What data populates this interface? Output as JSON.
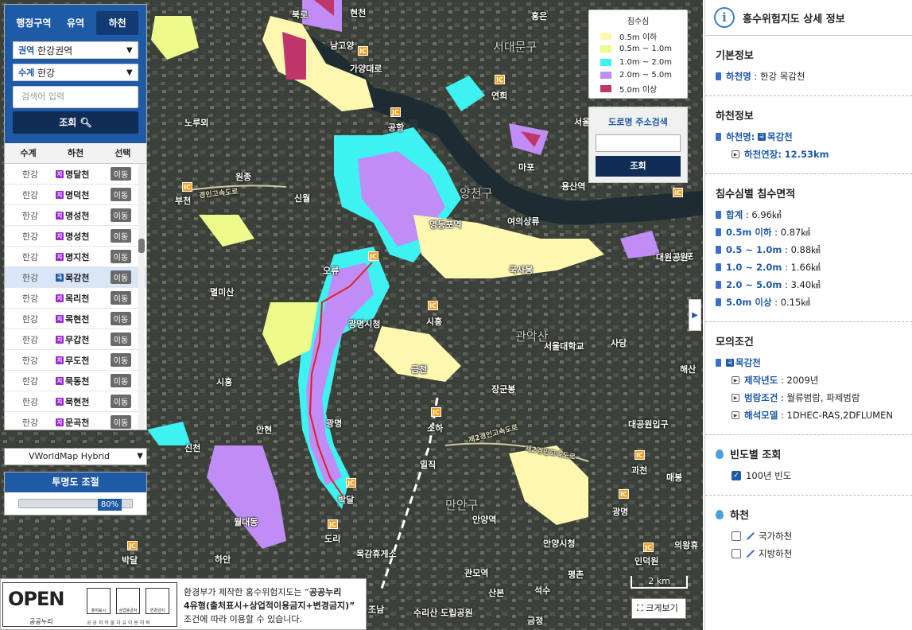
{
  "map": {
    "labels": [
      "북로",
      "현천",
      "남고양",
      "가양대로",
      "홍은",
      "서대문구",
      "연희",
      "노루뫼",
      "원종",
      "신월",
      "공항",
      "부천",
      "마포",
      "용산역",
      "서울",
      "양천구",
      "영등포역",
      "여의상류",
      "오류",
      "광명시청",
      "시흥",
      "국사봉",
      "관악산",
      "서울대학교",
      "사당",
      "반포",
      "멸미산",
      "광명",
      "금천",
      "장군봉",
      "해산",
      "안현",
      "시흥",
      "일직",
      "신천",
      "대공원입구",
      "대원공원",
      "과천",
      "매봉",
      "광명",
      "박달",
      "월대동",
      "도리",
      "소하",
      "안양역",
      "안양시청",
      "인덕원",
      "의왕휴",
      "하안",
      "박달",
      "만안구",
      "관모역",
      "평촌",
      "석수",
      "수리산 도립공원",
      "목감휴게소",
      "조남",
      "금정",
      "산본"
    ],
    "roads": [
      "경인고속도로",
      "제2경인고속도로",
      "제2경인고속도로"
    ],
    "scale": "2 km",
    "enlarge": "크게보기"
  },
  "left": {
    "tabs": [
      "행정구역",
      "유역",
      "하천"
    ],
    "region_key": "권역",
    "region_val": "한강권역",
    "system_key": "수계",
    "system_val": "한강",
    "search_placeholder": "검색어 입력",
    "search_btn": "조회",
    "cols": [
      "수계",
      "하천",
      "선택"
    ],
    "rows": [
      {
        "sys": "한강",
        "badge": "지",
        "name": "명달천",
        "btn": "이동"
      },
      {
        "sys": "한강",
        "badge": "지",
        "name": "명덕천",
        "btn": "이동"
      },
      {
        "sys": "한강",
        "badge": "지",
        "name": "명성천",
        "btn": "이동"
      },
      {
        "sys": "한강",
        "badge": "지",
        "name": "명성천",
        "btn": "이동"
      },
      {
        "sys": "한강",
        "badge": "지",
        "name": "명지천",
        "btn": "이동"
      },
      {
        "sys": "한강",
        "badge": "국",
        "name": "목감천",
        "btn": "이동"
      },
      {
        "sys": "한강",
        "badge": "지",
        "name": "목리천",
        "btn": "이동"
      },
      {
        "sys": "한강",
        "badge": "지",
        "name": "목현천",
        "btn": "이동"
      },
      {
        "sys": "한강",
        "badge": "지",
        "name": "무갑천",
        "btn": "이동"
      },
      {
        "sys": "한강",
        "badge": "지",
        "name": "무도천",
        "btn": "이동"
      },
      {
        "sys": "한강",
        "badge": "지",
        "name": "묵동천",
        "btn": "이동"
      },
      {
        "sys": "한강",
        "badge": "지",
        "name": "묵현천",
        "btn": "이동"
      },
      {
        "sys": "한강",
        "badge": "지",
        "name": "문곡천",
        "btn": "이동"
      }
    ],
    "basemap": "VWorldMap Hybrid",
    "opacity_title": "투명도 조절",
    "opacity": "80%"
  },
  "legend": {
    "title": "침수심",
    "items": [
      {
        "label": "0.5m 이하",
        "color": "#fdf7b0"
      },
      {
        "label": "0.5m ~ 1.0m",
        "color": "#ecfb8a"
      },
      {
        "label": "1.0m ~ 2.0m",
        "color": "#3ef2f2"
      },
      {
        "label": "2.0m ~ 5.0m",
        "color": "#c08cf5"
      },
      {
        "label": "5.0m 이상",
        "color": "#c0366a"
      }
    ]
  },
  "roadsearch": {
    "title": "도로명 주소검색",
    "btn": "조회"
  },
  "notice": {
    "line1a": "환경부가 제작한 홍수위험지도는 “",
    "line1b": "공공누리",
    "line2": "4유형(출처표시+상업적이용금지+변경금지)”",
    "line3": "조건에 따라 이용할 수 있습니다.",
    "logo": "OPEN",
    "logo_name": "공공누리",
    "logo_sub": "공 공 저 작 물   자 유 이 용 허 락",
    "box1": "출처표시",
    "box2": "상업용금지",
    "box3": "변경금지"
  },
  "right": {
    "title": "홍수위험지도 상세 정보",
    "basic_title": "기본정보",
    "basic_k": "하천명",
    "basic_v": "한강 목감천",
    "river_title": "하천정보",
    "river_k": "하천명:",
    "river_badge": "국",
    "river_v": "목감천",
    "len_k": "하천연장:",
    "len_v": "12.53km",
    "area_title": "침수심별 침수면적",
    "areas": [
      {
        "k": "합계",
        "v": "6.96㎢"
      },
      {
        "k": "0.5m 이하",
        "v": "0.87㎢"
      },
      {
        "k": "0.5 ~ 1.0m",
        "v": "0.88㎢"
      },
      {
        "k": "1.0 ~ 2.0m",
        "v": "1.66㎢"
      },
      {
        "k": "2.0 ~ 5.0m",
        "v": "3.40㎢"
      },
      {
        "k": "5.0m 이상",
        "v": "0.15㎢"
      }
    ],
    "sim_title": "모의조건",
    "sim_badge": "국",
    "sim_name": "목감천",
    "sim": [
      {
        "k": "제작년도",
        "v": "2009년"
      },
      {
        "k": "범람조건",
        "v": "월류범람, 파제범람"
      },
      {
        "k": "해석모델",
        "v": "1DHEC-RAS,2DFLUMEN"
      }
    ],
    "freq_title": "빈도별 조회",
    "freq_item": "100년 빈도",
    "riv_title": "하천",
    "riv1": "국가하천",
    "riv2": "지방하천"
  }
}
